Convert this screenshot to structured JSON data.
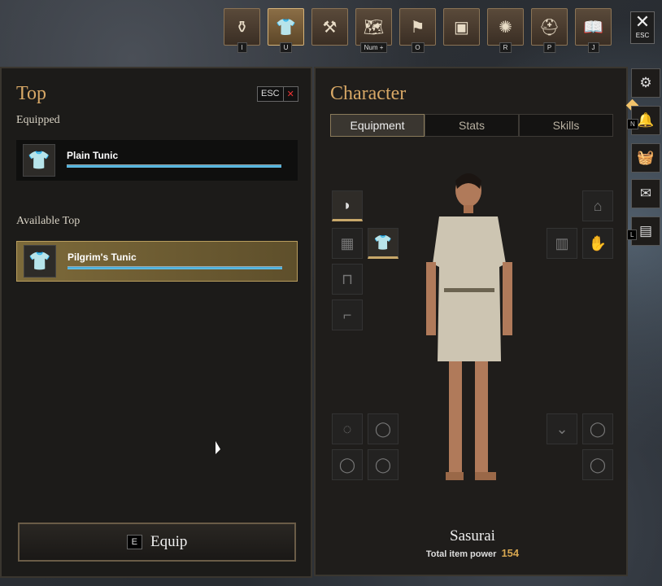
{
  "topnav": [
    {
      "icon": "bag-icon",
      "glyph": "⚱",
      "key": "I"
    },
    {
      "icon": "armor-icon",
      "glyph": "👕",
      "key": "U",
      "active": true
    },
    {
      "icon": "hammer-icon",
      "glyph": "⚒",
      "key": ""
    },
    {
      "icon": "map-icon",
      "glyph": "🗺",
      "key": "Num +"
    },
    {
      "icon": "banner-icon",
      "glyph": "⚑",
      "key": "O"
    },
    {
      "icon": "chest-icon",
      "glyph": "▣",
      "key": ""
    },
    {
      "icon": "compass-icon",
      "glyph": "✺",
      "key": "R"
    },
    {
      "icon": "helmet-icon",
      "glyph": "⛑",
      "key": "P"
    },
    {
      "icon": "journal-icon",
      "glyph": "📖",
      "key": "J"
    }
  ],
  "close": {
    "key": "ESC"
  },
  "left": {
    "title": "Top",
    "esc_label": "ESC",
    "equipped_label": "Equipped",
    "equipped_item": {
      "name": "Plain Tunic"
    },
    "available_label": "Available Top",
    "available_item": {
      "name": "Pilgrim's Tunic"
    },
    "equip_key": "E",
    "equip_label": "Equip"
  },
  "right": {
    "title": "Character",
    "tabs": [
      "Equipment",
      "Stats",
      "Skills"
    ],
    "character_name": "Sasurai",
    "power_label": "Total item power",
    "power_value": "154"
  },
  "sidebuttons": [
    {
      "icon": "gear-icon",
      "key": ""
    },
    {
      "icon": "bell-icon",
      "key": "N"
    },
    {
      "icon": "basket-icon",
      "key": ""
    },
    {
      "icon": "mail-icon",
      "key": ""
    },
    {
      "icon": "shop-icon",
      "key": "L"
    }
  ]
}
